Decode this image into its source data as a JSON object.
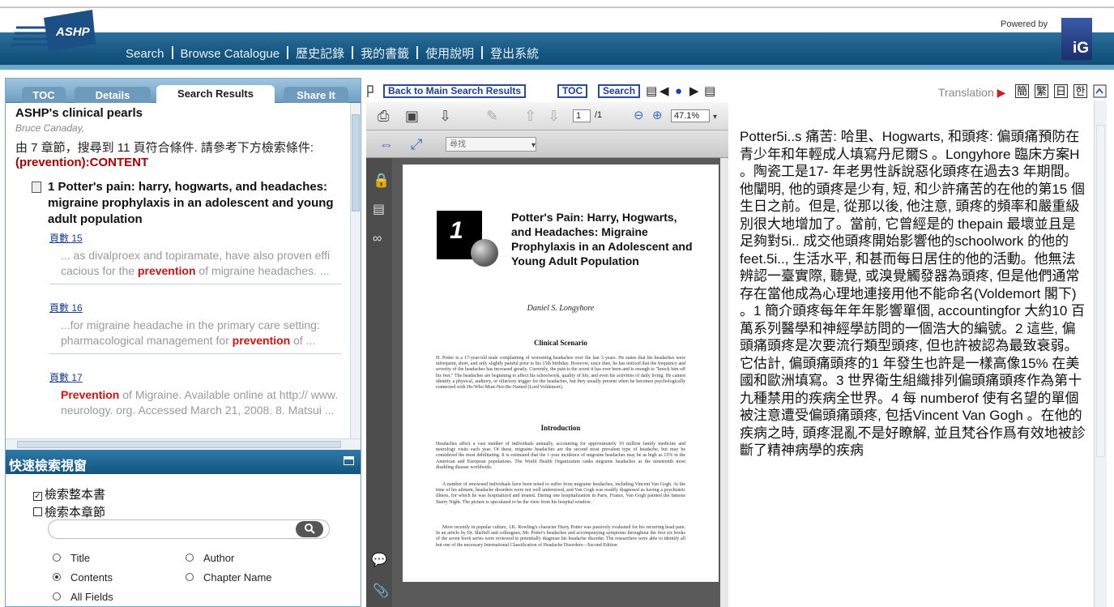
{
  "header": {
    "nav": [
      "Search",
      "Browse Catalogue",
      "歷史記錄",
      "我的書籤",
      "使用說明",
      "登出系統"
    ],
    "powered_by": "Powered by",
    "ig_logo": "iG",
    "logo_text": "ASHP"
  },
  "left_panel": {
    "tabs": [
      "TOC",
      "Details",
      "Search Results",
      "Share It"
    ],
    "active_tab": "Search Results",
    "book_title": "ASHP's clinical pearls",
    "book_author": "Bruce Canaday,",
    "summary": "由 7 章節，搜尋到 11 頁符合條件. 請參考下方檢索條件:",
    "query": "(prevention):CONTENT",
    "chapter_title": "1 Potter's pain: harry, hogwarts, and headaches: migraine prophylaxis in an adolescent and young adult population",
    "hits": [
      {
        "page": "頁數 15",
        "pre": "... as divalproex and topiramate, have also proven effi cacious for the ",
        "keyword": "prevention",
        "post": " of migraine headaches. ..."
      },
      {
        "page": "頁數 16",
        "pre": "...for migraine headache in the primary care setting: pharmacological management for ",
        "keyword": "prevention",
        "post": " of ..."
      },
      {
        "page": "頁數 17",
        "pre": "",
        "keyword": "Prevention",
        "post": " of Migraine. Available online at http:// www. neurology. org. Accessed March 21, 2008. 8. Matsui ..."
      }
    ]
  },
  "quick_search": {
    "title": "快速檢索視窗",
    "opt_book": "檢索整本書",
    "opt_chapter": "檢索本章節",
    "book_checked": true,
    "chapter_checked": false,
    "search_value": "",
    "fields": [
      "Title",
      "Author",
      "Contents",
      "Chapter Name",
      "All Fields"
    ],
    "selected_field": "Contents"
  },
  "viewer_bar": {
    "back_label": "Back to Main Search Results",
    "toc_label": "TOC",
    "search_label": "Search"
  },
  "pdf_viewer": {
    "page_current": "1",
    "page_total": "/1",
    "zoom": "47.1%",
    "find_placeholder": "尋找",
    "chapter_num": "1",
    "chapter_title": "Potter's Pain: Harry, Hogwarts, and Headaches: Migraine Prophylaxis in an Adolescent and Young Adult Population",
    "author": "Daniel S. Longyhore",
    "section1": "Clinical Scenario",
    "para1": "H. Potter is a 17-year-old male complaining of worsening headaches over the last 3 years. He states that his headaches were infrequent, short, and only slightly painful prior to his 15th birthday. However, since then, he has noticed that the frequency and severity of the headaches has increased greatly. Currently, the pain is the worst it has ever been and is enough to \"knock him off his feet.\" The headaches are beginning to affect his schoolwork, quality of life, and even his activities of daily living. He cannot identify a physical, auditory, or olfactory trigger for the headaches, but they usually present when he becomes psychologically connected with He-Who-Must-Not-Be-Named (Lord Voldemort).",
    "section2": "Introduction",
    "para2": "Headaches affect a vast number of individuals annually, accounting for approximately 10 million family medicine and neurology visits each year. Of these, migraine headaches are the second most prevalent type of headache, but may be considered the most debilitating. It is estimated that the 1-year incidence of migraine headaches may be as high as 15% in the American and European populations. The World Health Organization ranks migraine headaches as the nineteenth most disabling disease worldwide.",
    "para3": "A number of renowned individuals have been noted to suffer from migraine headaches, including Vincent Van Gogh. At the time of his ailment, headache disorders were not well understood, and Van Gogh was readily diagnosed as having a psychiatric illness, for which he was hospitalized and treated. During one hospitalization in Paris, France, Van Gogh painted the famous Starry Night. The picture is speculated to be the view from his hospital window.",
    "para4": "More recently in popular culture, J.K. Rowling's character Harry Potter was passively evaluated for his recurring head pain. In an article by Dr. Sheftell and colleagues, Mr. Potter's headaches and accompanying symptoms throughout the first six books of the seven book series were reviewed to potentially diagnose his headache disorder. The researchers were able to identify all but one of the necessary International Classification of Headache Disorders—Second Edition"
  },
  "translation": {
    "label": "Translation",
    "buttons": [
      "簡",
      "繁",
      "日",
      "한"
    ],
    "text": "Potter5i..s 痛苦: 哈里、Hogwarts, 和頭疼: 偏頭痛預防在青少年和年輕成人填寫丹尼爾S 。Longyhore 臨床方案H 。陶瓷工是17- 年老男性訴說惡化頭疼在過去3 年期間。他闡明, 他的頭疼是少有, 短, 和少許痛苦的在他的第15 個生日之前。但是, 從那以後, 他注意, 頭疼的頻率和嚴重級別很大地增加了。當前, 它曾經是的 thepain 最壞並且是足夠對5i.. 成交他頭疼開始影響他的schoolwork 的他的feet.5i.., 生活水平, 和甚而每日居住的他的活動。他無法辨認一臺實際, 聽覺, 或溴覺觸發器為頭疼, 但是他們通常存在當他成為心理地連接用他不能命名(Voldemort 閣下) 。1 簡介頭疼每年年年影響單個, accountingfor 大約10 百萬系列醫學和神經學訪問的一個浩大的編號。2 這些, 偏頭痛頭疼是次要流行類型頭疼, 但也許被認為最致衰弱。它估計, 偏頭痛頭疼的1 年發生也許是一樣高像15% 在美國和歐洲填寫。3 世界衛生組織排列偏頭痛頭疼作為第十九種禁用的疾病全世界。4 每 numberof 使有名望的單個被注意遭受偏頭痛頭疼, 包括Vincent Van Gogh 。在他的疾病之時, 頭疼混亂不是好瞭解, 並且梵谷作爲有效地被診斷了精神病學的疾病"
  }
}
